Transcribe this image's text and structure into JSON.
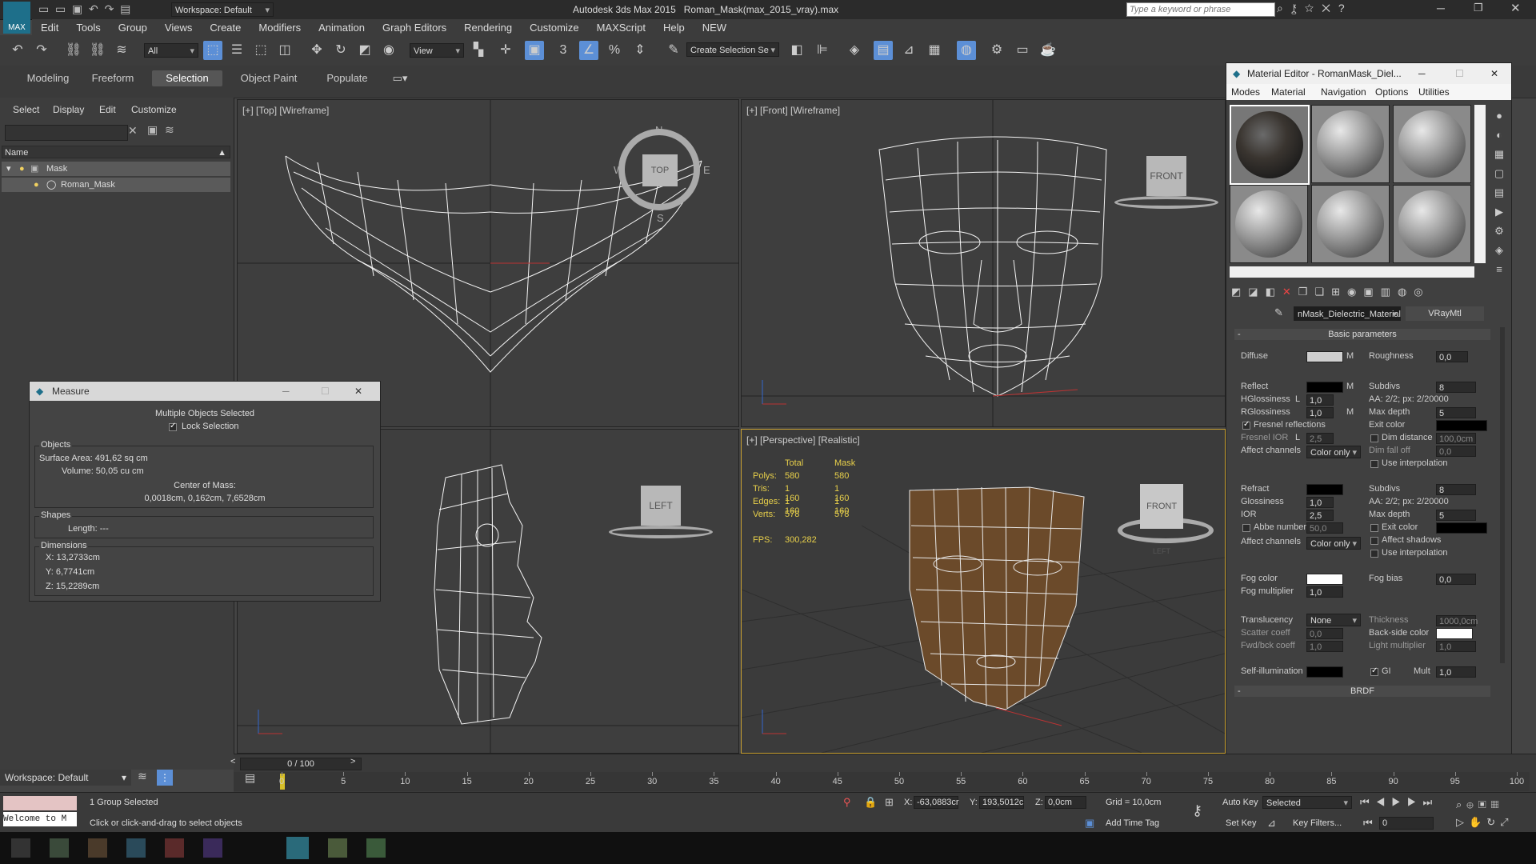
{
  "window": {
    "app_title": "Autodesk 3ds Max  2015",
    "file_title": "Roman_Mask(max_2015_vray).max",
    "workspace": "Workspace: Default",
    "search_placeholder": "Type a keyword or phrase"
  },
  "menu": [
    "Edit",
    "Tools",
    "Group",
    "Views",
    "Create",
    "Modifiers",
    "Animation",
    "Graph Editors",
    "Rendering",
    "Customize",
    "MAXScript",
    "Help",
    "NEW"
  ],
  "toolbar": {
    "filter": "All",
    "ref_coord": "View",
    "selection_set": "Create Selection Se",
    "snap_labels": [
      "3",
      "%"
    ]
  },
  "ribbon_tabs": [
    {
      "label": "Modeling",
      "active": false
    },
    {
      "label": "Freeform",
      "active": false
    },
    {
      "label": "Selection",
      "active": true
    },
    {
      "label": "Object Paint",
      "active": false
    },
    {
      "label": "Populate",
      "active": false
    }
  ],
  "explorer": {
    "menu": [
      "Select",
      "Display",
      "Edit",
      "Customize"
    ],
    "column": "Name",
    "items": [
      "Mask",
      "Roman_Mask"
    ]
  },
  "viewports": {
    "top": {
      "label": "[+] [Top] [Wireframe]",
      "cube": "TOP",
      "compass": [
        "N",
        "W",
        "E",
        "S"
      ]
    },
    "front": {
      "label": "[+] [Front] [Wireframe]",
      "cube": "FRONT"
    },
    "left": {
      "cube": "LEFT"
    },
    "perspective": {
      "label": "[+] [Perspective] [Realistic]",
      "cube": "FRONT",
      "cube_side": "LEFT",
      "stats": {
        "headers": [
          "Total",
          "Mask"
        ],
        "rows": [
          {
            "label": "Polys:",
            "total": "580",
            "mask": "580"
          },
          {
            "label": "Tris:",
            "total": "1 160",
            "mask": "1 160"
          },
          {
            "label": "Edges:",
            "total": "1 160",
            "mask": "1 160"
          },
          {
            "label": "Verts:",
            "total": "578",
            "mask": "578"
          }
        ],
        "fps_label": "FPS:",
        "fps": "300,282"
      }
    }
  },
  "measure": {
    "title": "Measure",
    "status": "Multiple Objects Selected",
    "lock": "Lock Selection",
    "objects_group": "Objects",
    "surface_area": "Surface Area: 491,62 sq cm",
    "volume": "Volume: 50,05 cu cm",
    "com_label": "Center of Mass:",
    "com_value": "0,0018cm, 0,162cm, 7,6528cm",
    "shapes_group": "Shapes",
    "length": "Length: ---",
    "dimensions_group": "Dimensions",
    "x": "X:  13,2733cm",
    "y": "Y:  6,7741cm",
    "z": "Z:  15,2289cm"
  },
  "mateditor": {
    "title": "Material Editor - RomanMask_Diel...",
    "menu": [
      "Modes",
      "Material",
      "Navigation",
      "Options",
      "Utilities"
    ],
    "material_name": "nMask_Dielectric_Material",
    "material_type": "VRayMtl",
    "rollout": "Basic parameters",
    "brdf": "BRDF",
    "params": {
      "diffuse": "Diffuse",
      "m": "M",
      "roughness": "Roughness",
      "roughness_val": "0,0",
      "reflect": "Reflect",
      "subdivs": "Subdivs",
      "subdivs_val": "8",
      "hgloss": "HGlossiness",
      "l": "L",
      "hgloss_val": "1,0",
      "aa": "AA: 2/2; px: 2/20000",
      "rgloss": "RGlossiness",
      "rgloss_val": "1,0",
      "maxdepth": "Max depth",
      "maxdepth_val": "5",
      "fresnel": "Fresnel reflections",
      "exit_color": "Exit color",
      "fresnel_ior": "Fresnel IOR",
      "fresnel_ior_val": "2,5",
      "dim_distance": "Dim distance",
      "dim_distance_val": "100,0cm",
      "affect": "Affect channels",
      "affect_val": "Color only",
      "dim_falloff": "Dim fall off",
      "dim_falloff_val": "0,0",
      "use_interp": "Use interpolation",
      "refract": "Refract",
      "r_subdivs_val": "8",
      "glossiness": "Glossiness",
      "glossiness_val": "1,0",
      "ior": "IOR",
      "ior_val": "2,5",
      "r_maxdepth_val": "5",
      "abbe": "Abbe number",
      "abbe_val": "50,0",
      "r_exit": "Exit color",
      "affect_shadows": "Affect shadows",
      "fog_color": "Fog color",
      "fog_bias": "Fog bias",
      "fog_bias_val": "0,0",
      "fog_mult": "Fog multiplier",
      "fog_mult_val": "1,0",
      "translucency": "Translucency",
      "translucency_val": "None",
      "thickness": "Thickness",
      "thickness_val": "1000,0cm",
      "scatter": "Scatter coeff",
      "scatter_val": "0,0",
      "backside": "Back-side color",
      "fwdbck": "Fwd/bck coeff",
      "fwdbck_val": "1,0",
      "light_mult": "Light multiplier",
      "light_mult_val": "1,0",
      "selfillum": "Self-illumination",
      "gi": "GI",
      "mult": "Mult",
      "mult_val": "1,0"
    }
  },
  "timeline": {
    "frame": "0 / 100",
    "ticks": [
      "0",
      "5",
      "10",
      "15",
      "20",
      "25",
      "30",
      "35",
      "40",
      "45",
      "50",
      "55",
      "60",
      "65",
      "70",
      "75",
      "80",
      "85",
      "90",
      "95",
      "100"
    ]
  },
  "status": {
    "workspace": "Workspace: Default",
    "welcome": "Welcome to M",
    "selected": "1 Group Selected",
    "prompt": "Click or click-and-drag to select objects",
    "x_label": "X:",
    "x_val": "-63,0883cr",
    "y_label": "Y:",
    "y_val": "193,5012c",
    "z_label": "Z:",
    "z_val": "0,0cm",
    "grid": "Grid = 10,0cm",
    "add_time_tag": "Add Time Tag",
    "auto_key": "Auto Key",
    "set_key": "Set Key",
    "key_mode": "Selected",
    "key_filters": "Key Filters...",
    "frame_val": "0"
  },
  "colors": {
    "accent": "#5c8fd6",
    "viewport_active": "#c8a032"
  }
}
